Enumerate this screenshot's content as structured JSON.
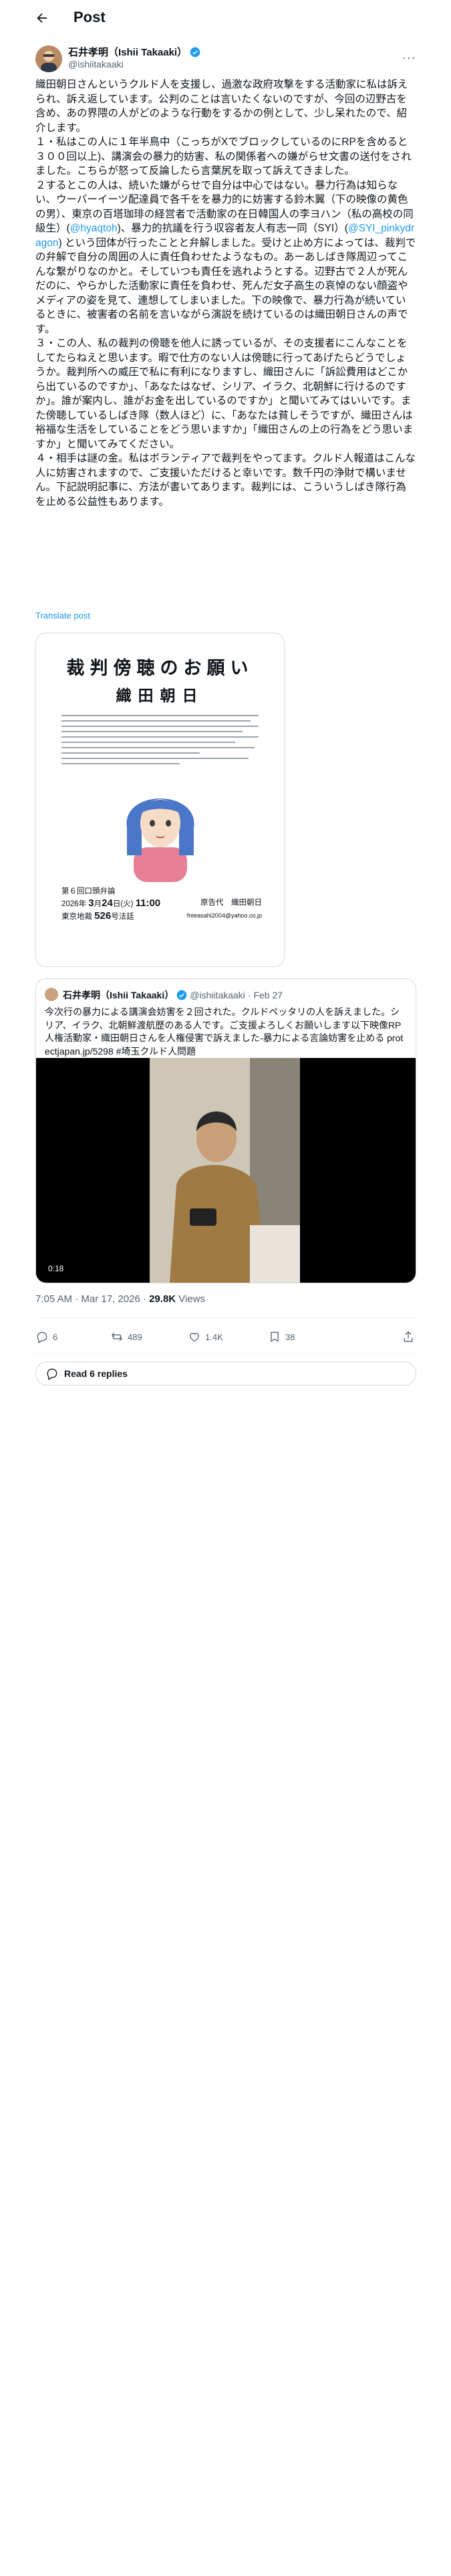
{
  "header": {
    "title": "Post"
  },
  "author": {
    "name": "石井孝明（Ishii Takaaki）",
    "handle": "@ishiitakaaki"
  },
  "tweet": {
    "paragraphs": [
      {
        "segments": [
          {
            "text": "織田朝日さんというクルド人を支援し、過激な政府攻撃をする活動家に私は訴えられ、訴え返しています。公判のことは言いたくないのですが、今回の辺野古を含め、あの界隈の人がどのような行動をするかの例として、少し呆れたので、紹介します。"
          }
        ]
      },
      {
        "segments": [
          {
            "text": "１・私はこの人に１年半鳥中（こっちがXでブロックしているのにRPを含めると３００回以上)、講演会の暴力的妨害、私の関係者への嫌がらせ文書の送付をされました。こちらが怒って反論したら言葉尻を取って訴えてきました。"
          }
        ]
      },
      {
        "segments": [
          {
            "text": "２するとこの人は、続いた嫌がらせで自分は中心ではない。暴力行為は知らない、ウーバーイーツ配達員で各千をを暴力的に妨害する鈴木翼（下の映像の黄色の男）、東京の百塔珈琲の経営者で活動家の在日韓国人の李ヨハン（私の高校の同級生）("
          },
          {
            "text": "@hyaqtoh",
            "mention": true
          },
          {
            "text": ")、暴力的抗議を行う収容者友人有志一同（SYI）("
          },
          {
            "text": "@SYI_pinkydragon",
            "mention": true
          },
          {
            "text": ") という団体が行ったことと弁解しました。受けと止め方によっては、裁判での弁解で自分の周囲の人に責任負わせたようなもの。あーあしばき隊周辺ってこんな繋がりなのかと。そしていつも責任を逃れようとする。辺野古で２人が死んだのに、やらかした活動家に責任を負わせ、死んだ女子高生の哀悼のない顔盗やメディアの姿を見て、連想してしまいました。下の映像で、暴力行為が続いているときに、被害者の名前を言いながら演説を続けているのは織田朝日さんの声です。"
          }
        ]
      },
      {
        "segments": [
          {
            "text": "３・この人、私の裁判の傍聴を他人に誘っているが、その支援者にこんなことをしてたらねえと思います。暇で仕方のない人は傍聴に行ってあげたらどうでしょうか。裁判所への威圧で私に有利になりますし、織田さんに「訴訟費用はどこから出ているのですか」、「あなたはなぜ、シリア、イラク、北朝鮮に行けるのですか」。誰が案内し、誰がお金を出しているのですか」と聞いてみてはいいです。また傍聴しているしばき隊（数人ほど）に、「あなたは貧しそうですが、織田さんは裕福な生活をしていることをどう思いますか」「織田さんの上の行為をどう思いますか」と聞いてみてください。"
          }
        ]
      },
      {
        "segments": [
          {
            "text": "４・相手は謎の金。私はボランティアで裁判をやってます。クルド人報道はこんな人に妨害されますので、ご支援いただけると幸いです。数千円の浄財で構いません。下記説明記事に、方法が書いてあります。裁判には、こういうしばき隊行為を止める公益性もあります。"
          }
        ]
      }
    ],
    "translate_label": "Translate post"
  },
  "flyer": {
    "title_line1": "裁判傍聴のお願い",
    "title_line2": "織田朝日",
    "session": "第６回口頭弁論",
    "date_label": "2026年",
    "date_month": "3",
    "date_month_unit": "月",
    "date_day": "24",
    "date_day_unit": "日",
    "date_weekday": "(火)",
    "time": "11:00",
    "court": "東京地裁",
    "room": "526",
    "room_unit": "号法廷",
    "plaintiff_label": "原告代　織田朝日",
    "email": "freeasahi2004@yahoo.co.jp"
  },
  "quote": {
    "author": "石井孝明（Ishii Takaaki）",
    "handle": "@ishiitakaaki",
    "date": "· Feb 27",
    "text": "今次行の暴力による講演会妨害を２回された。クルドペッタリの人を訴えました。シリア、イラク、北朝鮮渡航歴のある人です。ご支援よろしくお願いします以下映像RP人権活動家・織田朝日さんを人権侵害で訴えました-暴力による言論妨害を止める protectjapan.jp/5298 #埼玉クルド人問題",
    "video_time": "0:18"
  },
  "meta": {
    "time_date": "7:05 AM · Mar 17, 2026 · ",
    "views_count": "29.8K",
    "views_label": " Views"
  },
  "actions": {
    "replies": "6",
    "reposts": "489",
    "likes": "1.4K",
    "bookmarks": "38"
  },
  "read_replies_label": "Read 6 replies",
  "colors": {
    "accent": "#1d9bf0",
    "text": "#0f1419",
    "muted": "#536471",
    "border": "#cfd9de"
  }
}
